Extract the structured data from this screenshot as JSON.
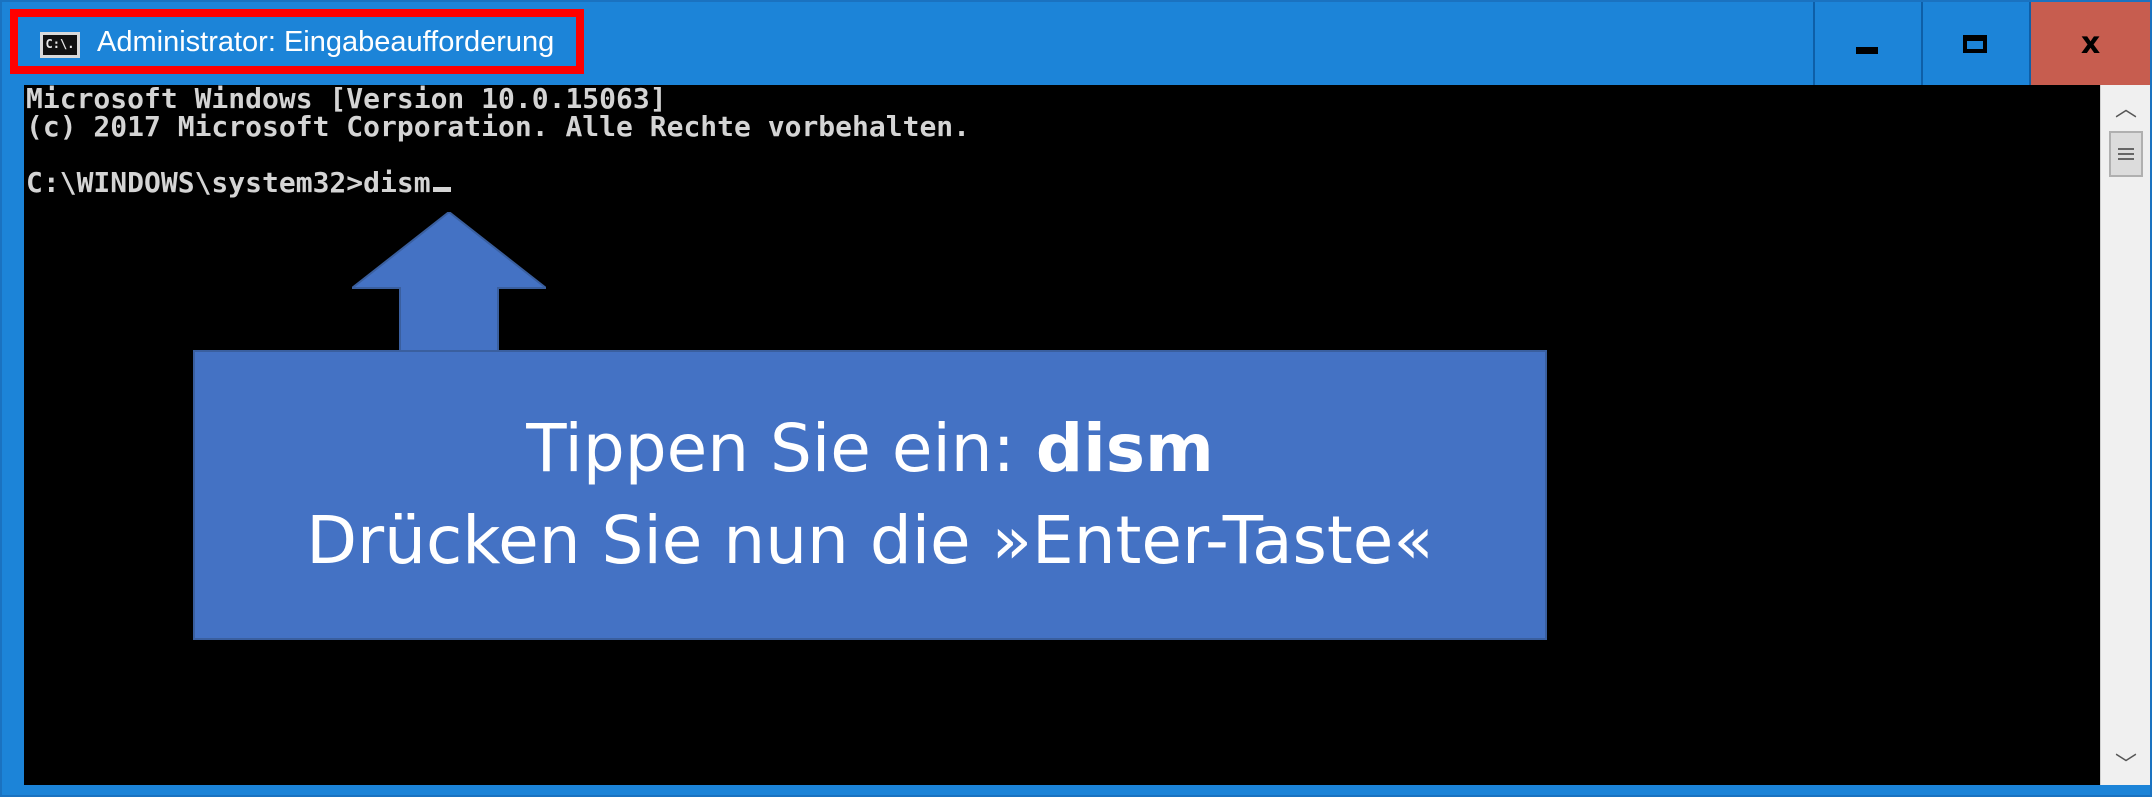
{
  "window": {
    "title": "Administrator: Eingabeaufforderung",
    "icon_label": "C:\\.",
    "buttons": {
      "minimize": "minimize-icon",
      "maximize": "maximize-icon",
      "close": "close-icon",
      "close_glyph": "x"
    }
  },
  "console": {
    "lines": [
      "Microsoft Windows [Version 10.0.15063]",
      "(c) 2017 Microsoft Corporation. Alle Rechte vorbehalten.",
      "C:\\WINDOWS\\system32>dism"
    ]
  },
  "annotation": {
    "line1_prefix": "Tippen Sie ein: ",
    "line1_command": "dism",
    "line2": "Drücken Sie nun die »Enter-Taste«"
  },
  "scrollbar": {
    "up": "chevron-up-icon",
    "down": "chevron-down-icon",
    "up_glyph": "︿",
    "down_glyph": "﹀"
  },
  "colors": {
    "titlebar": "#1c84d8",
    "highlight": "#ff0000",
    "close": "#c75d4f",
    "console_bg": "#000000",
    "console_text": "#d4d4d4",
    "callout": "#4472c4"
  }
}
